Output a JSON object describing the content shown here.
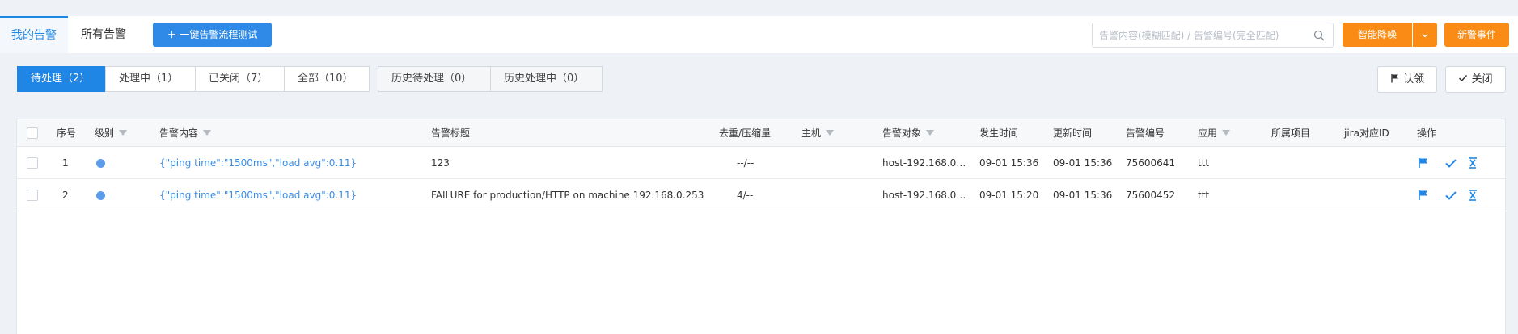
{
  "tabs": {
    "mine": "我的告警",
    "all": "所有告警"
  },
  "toolbar": {
    "flow_test_label": "＋  一键告警流程测试",
    "search_placeholder": "告警内容(模糊匹配) / 告警编号(完全匹配)",
    "smart_label": "智能降噪",
    "new_event_label": "新警事件"
  },
  "filters": {
    "status": [
      "待处理（2）",
      "处理中（1）",
      "已关闭（7）",
      "全部（10）"
    ],
    "history": [
      "历史待处理（0）",
      "历史处理中（0）"
    ],
    "claim_label": "认领",
    "close_label": "关闭"
  },
  "table": {
    "headers": {
      "index": "序号",
      "level": "级别",
      "content": "告警内容",
      "title": "告警标题",
      "dedup": "去重/压缩量",
      "host": "主机",
      "target": "告警对象",
      "occurred": "发生时间",
      "updated": "更新时间",
      "number": "告警编号",
      "app": "应用",
      "project": "所属项目",
      "jira": "jira对应ID",
      "actions": "操作"
    },
    "rows": [
      {
        "index": "1",
        "content": "{\"ping time\":\"1500ms\",\"load avg\":0.11}",
        "title": "123",
        "dedup": "--/--",
        "host": "",
        "target": "host-192.168.0....",
        "occurred": "09-01 15:36",
        "updated": "09-01 15:36",
        "number": "75600641",
        "app": "ttt",
        "project": "",
        "jira": ""
      },
      {
        "index": "2",
        "content": "{\"ping time\":\"1500ms\",\"load avg\":0.11}",
        "title": "FAILURE for production/HTTP on machine 192.168.0.253",
        "dedup": "4/--",
        "host": "",
        "target": "host-192.168.0....",
        "occurred": "09-01 15:20",
        "updated": "09-01 15:36",
        "number": "75600452",
        "app": "ttt",
        "project": "",
        "jira": ""
      }
    ]
  },
  "colors": {
    "accent": "#1f86e5",
    "orange": "#fa8c16",
    "level_dot": "#5d9cec"
  }
}
